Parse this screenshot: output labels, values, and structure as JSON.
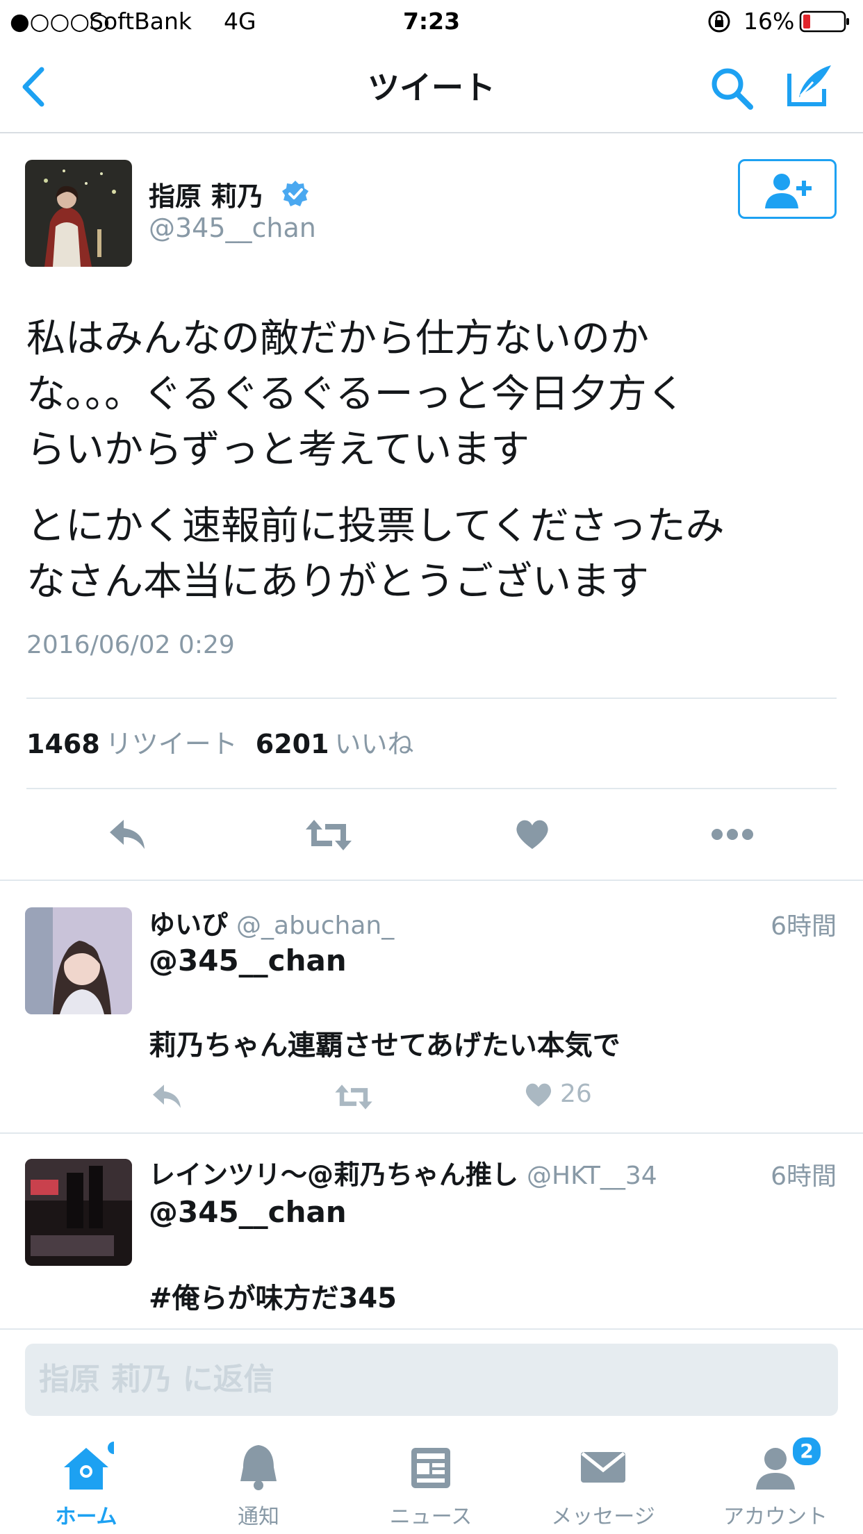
{
  "status_bar": {
    "signal": "●○○○○",
    "carrier": "SoftBank",
    "network": "4G",
    "time": "7:23",
    "battery": "16%"
  },
  "nav": {
    "title": "ツイート",
    "back_icon": "chevron-left-icon",
    "search_icon": "search-icon",
    "compose_icon": "compose-icon"
  },
  "tweet": {
    "name": "指原 莉乃",
    "handle": "@345__chan",
    "verified": true,
    "paragraphs": [
      [
        "私はみんなの敵だから仕方ないのか",
        "な。。。ぐるぐるぐるーっと今日夕方く",
        "らいからずっと考えています"
      ],
      [
        "とにかく速報前に投票してくださったみ",
        "なさん本当にありがとうございます"
      ]
    ],
    "timestamp": "2016/06/02 0:29",
    "retweets": "1468",
    "retweets_label": "リツイート",
    "likes": "6201",
    "likes_label": "いいね"
  },
  "replies": [
    {
      "name": "ゆいぴ",
      "handle": "@_abuchan_",
      "time": "6時間",
      "mention": "@345__chan",
      "text": "莉乃ちゃん連覇させてあげたい本気で",
      "likes": "26"
    },
    {
      "name": "レインツリ〜@莉乃ちゃん推し",
      "handle": "@HKT__34",
      "time": "6時間",
      "mention": "@345__chan",
      "text": "#俺らが味方だ345"
    }
  ],
  "reply_box": {
    "placeholder": "指原 莉乃 に返信"
  },
  "tabs": [
    {
      "label": "ホーム",
      "icon": "home-icon",
      "active": true
    },
    {
      "label": "通知",
      "icon": "bell-icon"
    },
    {
      "label": "ニュース",
      "icon": "news-icon"
    },
    {
      "label": "メッセージ",
      "icon": "envelope-icon"
    },
    {
      "label": "アカウント",
      "icon": "account-icon",
      "badge": "2"
    }
  ],
  "colors": {
    "accent": "#1da1f2",
    "muted": "#8899a6",
    "text": "#14171a",
    "battery_low": "#e0242b"
  }
}
